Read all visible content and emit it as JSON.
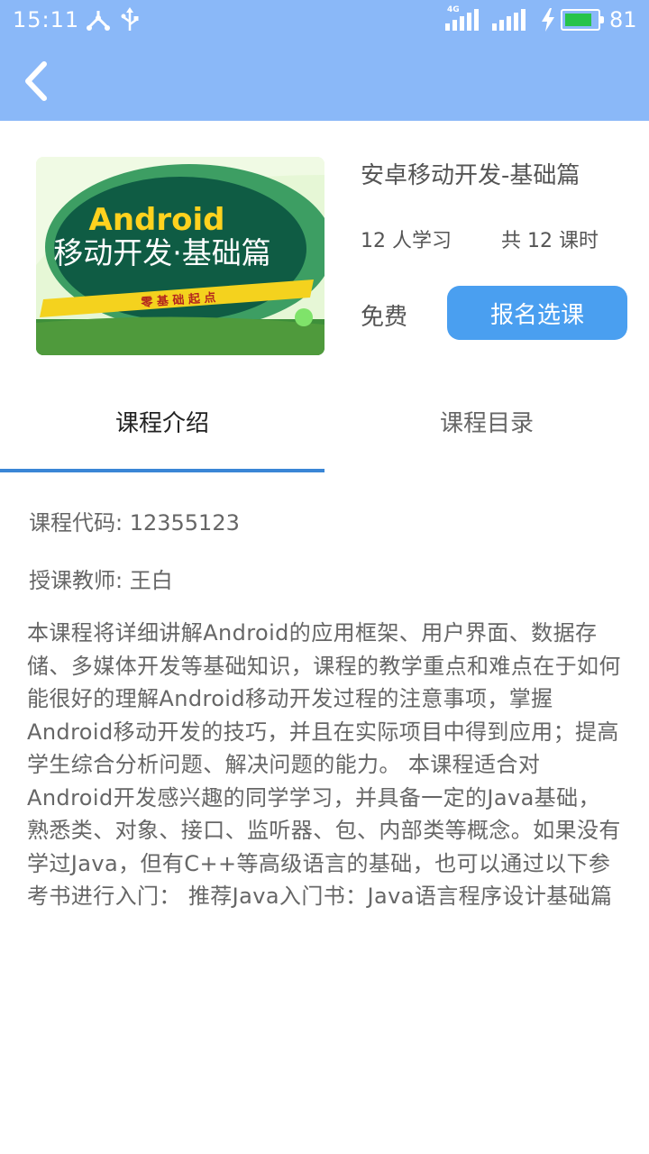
{
  "status_bar": {
    "time": "15:11",
    "network_label": "4G",
    "battery_level": "81",
    "battery_fraction": 0.81,
    "icons": [
      "usb-tether-icon",
      "usb-icon",
      "signal-4g-icon",
      "signal-icon",
      "charging-icon",
      "battery-icon"
    ]
  },
  "app_bar": {
    "back_icon": "chevron-left-icon",
    "color": "#8ab8f8"
  },
  "course": {
    "cover": {
      "line1": "Android",
      "line2": "移动开发·基础篇",
      "ribbon": "零 基 础 起 点"
    },
    "title": "安卓移动开发-基础篇",
    "students": "12 人学习",
    "lessons": "共 12 课时",
    "price": "免费",
    "enroll_label": "报名选课",
    "enroll_color": "#4a9ff0"
  },
  "tabs": [
    {
      "label": "课程介绍",
      "active": true
    },
    {
      "label": "课程目录",
      "active": false
    }
  ],
  "intro": {
    "code": "课程代码: 12355123",
    "teacher": "授课教师: 王白",
    "description": "本课程将详细讲解Android的应用框架、用户界面、数据存储、多媒体开发等基础知识，课程的教学重点和难点在于如何能很好的理解Android移动开发过程的注意事项，掌握Android移动开发的技巧，并且在实际项目中得到应用；提高学生综合分析问题、解决问题的能力。 本课程适合对Android开发感兴趣的同学学习，并具备一定的Java基础，熟悉类、对象、接口、监听器、包、内部类等概念。如果没有学过Java，但有C++等高级语言的基础，也可以通过以下参考书进行入门： 推荐Java入门书：Java语言程序设计基础篇"
  }
}
